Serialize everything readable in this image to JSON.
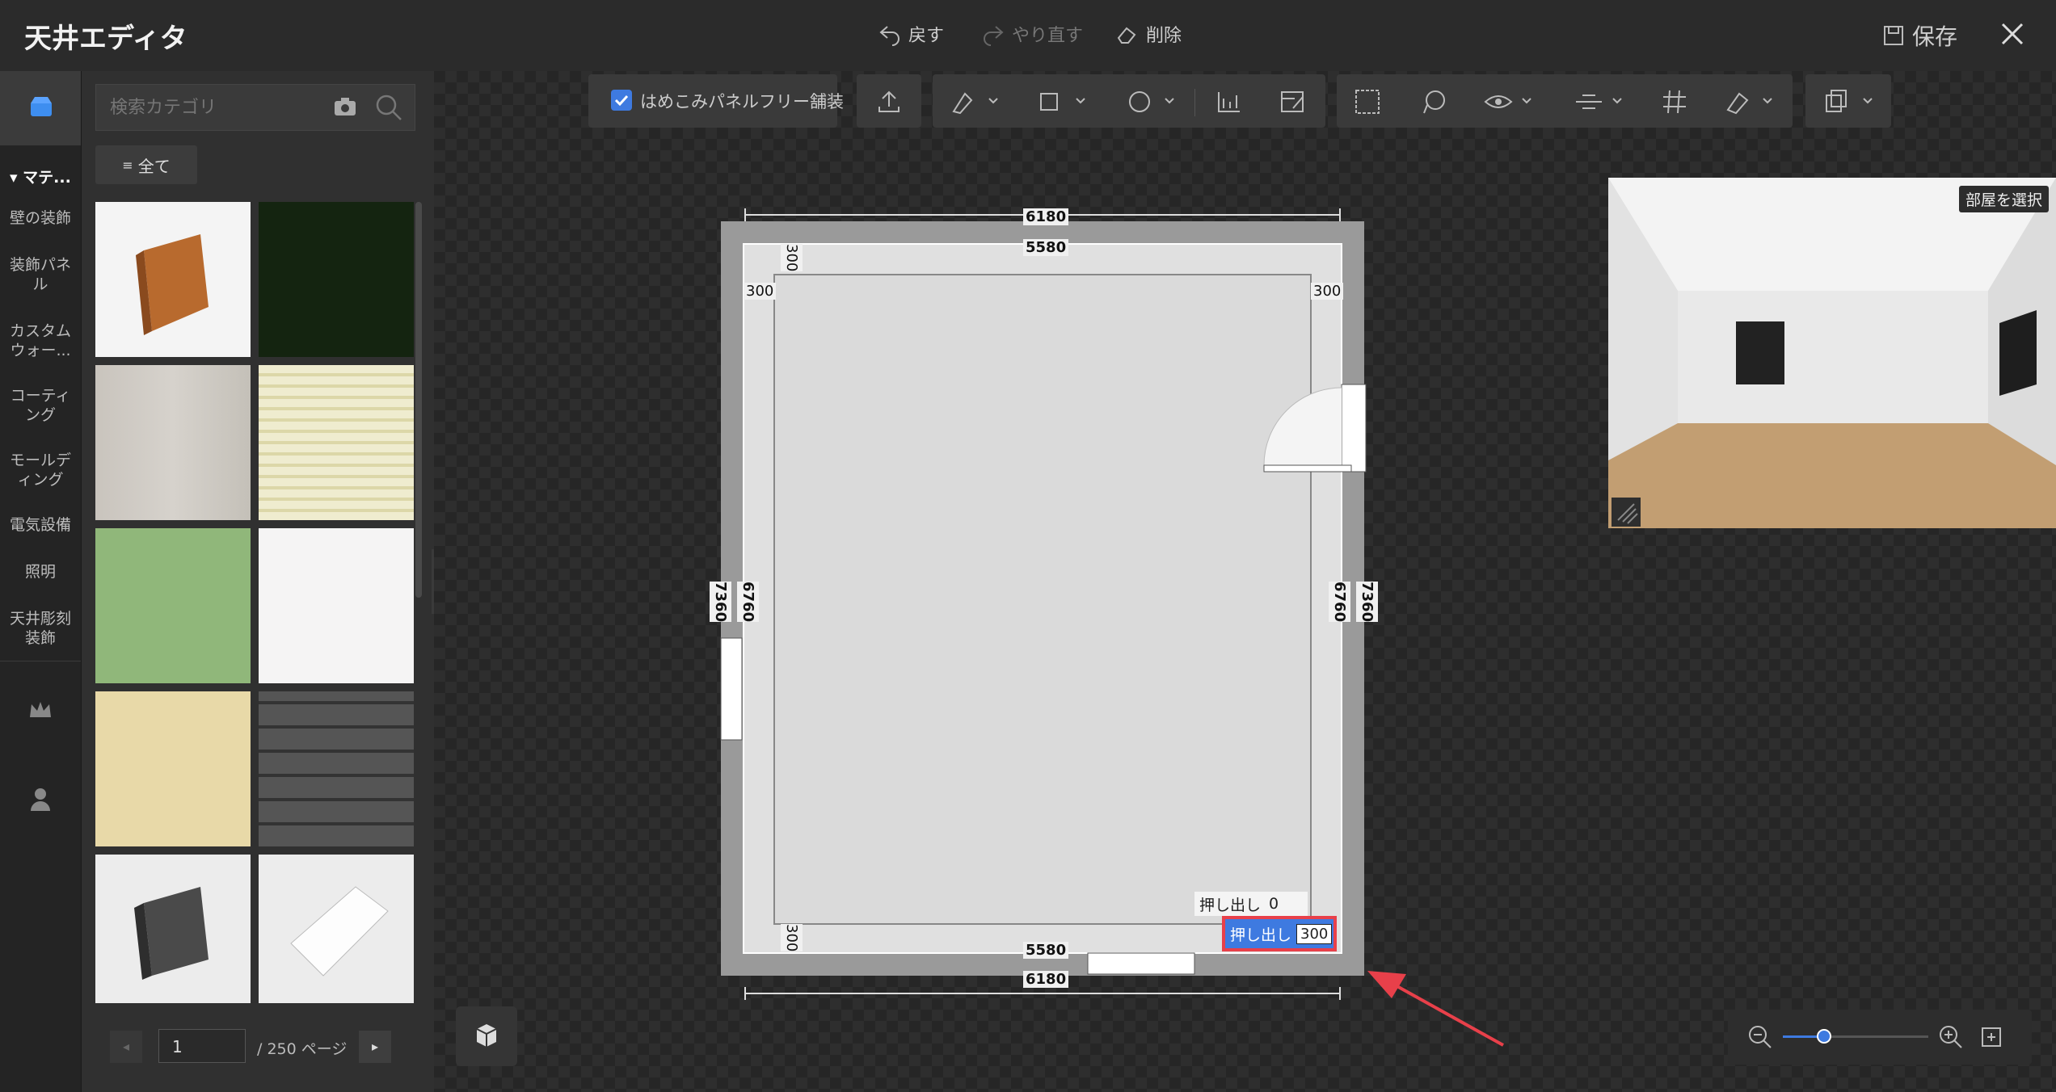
{
  "header": {
    "title": "天井エディタ",
    "undo": "戻す",
    "redo": "やり直す",
    "delete": "削除",
    "save": "保存"
  },
  "sidebar": {
    "section": "マテ...",
    "items": [
      {
        "label": "壁の装飾"
      },
      {
        "label": "装飾パネル"
      },
      {
        "label": "カスタムウォー..."
      },
      {
        "label": "コーティング"
      },
      {
        "label": "モールディング"
      },
      {
        "label": "電気設備"
      },
      {
        "label": "照明"
      },
      {
        "label": "天井彫刻装飾"
      }
    ]
  },
  "panel": {
    "search_placeholder": "検索カテゴリ",
    "filter": "全て",
    "pager": {
      "page": "1",
      "total": "/ 250 ページ"
    }
  },
  "toolbar": {
    "checkbox_label": "はめこみパネルフリー舗装"
  },
  "plan": {
    "outer_w": "6180",
    "inner_w": "5580",
    "outer_h": "7360",
    "inner_h": "6760",
    "offset": "300",
    "extrude_label": "押し出し",
    "extrude_top_value": "0",
    "extrude_active_value": "300"
  },
  "preview": {
    "room_select": "部屋を選択"
  },
  "colors": {
    "accent": "#3e7ae0",
    "highlight": "#e8404a"
  }
}
